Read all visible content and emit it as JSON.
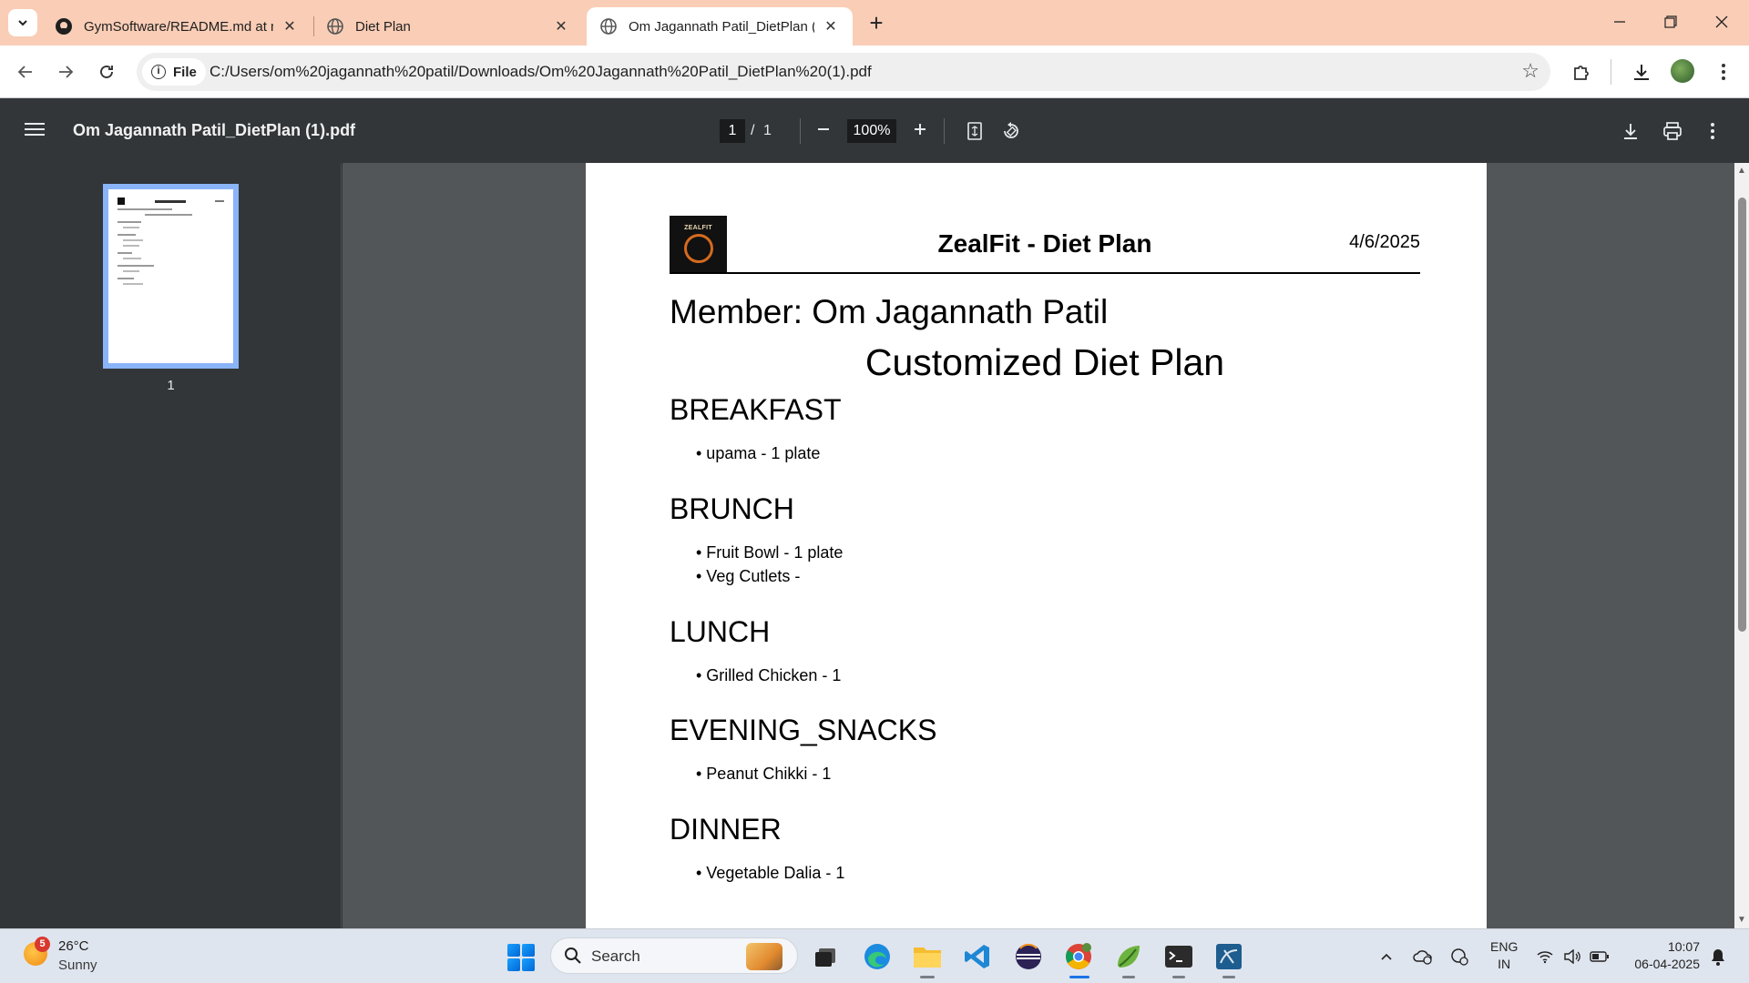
{
  "browser": {
    "tabs": [
      {
        "title": "GymSoftware/README.md at m",
        "favicon": "github-icon",
        "active": false
      },
      {
        "title": "Diet Plan",
        "favicon": "globe-icon",
        "active": false
      },
      {
        "title": "Om Jagannath Patil_DietPlan (1).",
        "favicon": "globe-icon",
        "active": true
      }
    ],
    "omnibox": {
      "chip_label": "File",
      "url": "C:/Users/om%20jagannath%20patil/Downloads/Om%20Jagannath%20Patil_DietPlan%20(1).pdf"
    },
    "accent_color": "#f9cdb6"
  },
  "pdf_viewer": {
    "file_name": "Om Jagannath Patil_DietPlan (1).pdf",
    "current_page": "1",
    "page_separator": "/",
    "total_pages": "1",
    "zoom": "100%",
    "thumbnail_label": "1"
  },
  "document": {
    "logo_text": "ZEALFIT",
    "title": "ZealFit - Diet Plan",
    "date": "4/6/2025",
    "member_line": "Member: Om Jagannath Patil",
    "plan_title": "Customized Diet Plan",
    "sections": [
      {
        "heading": "BREAKFAST",
        "items": [
          "• upama - 1 plate"
        ]
      },
      {
        "heading": "BRUNCH",
        "items": [
          "• Fruit Bowl - 1 plate",
          "• Veg Cutlets -"
        ]
      },
      {
        "heading": "LUNCH",
        "items": [
          "• Grilled Chicken - 1"
        ]
      },
      {
        "heading": "EVENING_SNACKS",
        "items": [
          "• Peanut Chikki - 1"
        ]
      },
      {
        "heading": "DINNER",
        "items": [
          "• Vegetable Dalia - 1"
        ]
      }
    ]
  },
  "taskbar": {
    "weather_badge": "5",
    "temperature": "26°C",
    "condition": "Sunny",
    "search_label": "Search",
    "language_line1": "ENG",
    "language_line2": "IN",
    "time": "10:07",
    "date": "06-04-2025"
  }
}
